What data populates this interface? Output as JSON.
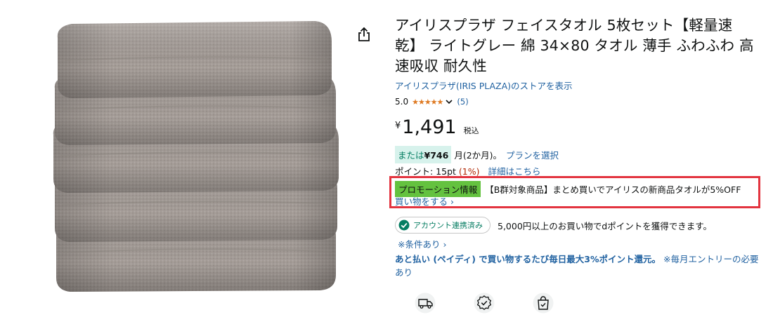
{
  "product": {
    "title": "アイリスプラザ フェイスタオル 5枚セット【軽量速乾】 ライトグレー 綿 34×80 タオル 薄手 ふわふわ 高速吸収 耐久性",
    "store_link": "アイリスプラザ(IRIS PLAZA)のストアを表示",
    "rating_value": "5.0",
    "stars": "★★★★★",
    "review_count": "(5)"
  },
  "price": {
    "currency_symbol": "¥",
    "amount": "1,491",
    "tax_label": "税込"
  },
  "installment": {
    "prefix": "または",
    "amount": "¥746",
    "suffix": "月(2か月)。",
    "plan_link": "プランを選択"
  },
  "points": {
    "label": "ポイント: 15pt",
    "percent": "(1%)",
    "detail_link": "詳細はこちら"
  },
  "promotion": {
    "badge": "プロモーション情報",
    "text": "【B群対象商品】まとめ買いでアイリスの新商品タオルが5%OFF",
    "shop_link": "買い物をする ›"
  },
  "account": {
    "badge_label": "アカウント連携済み",
    "dpoint_text": "5,000円以上のお買い物でdポイントを獲得できます。"
  },
  "terms_link": "※条件あり ›",
  "paidy": {
    "main": "あと払い (ペイディ) で買い物するたび毎日最大3%ポイント還元。",
    "note": "※毎月エントリーの必要あり"
  },
  "icons": {
    "share": "share-icon",
    "delivery": "delivery-truck-icon",
    "quality": "quality-badge-icon",
    "secure": "secure-bag-icon"
  },
  "colors": {
    "link": "#2162a1",
    "star": "#de7921",
    "promo_badge": "#64c23f",
    "highlight_border": "#e3343f",
    "installment_bg": "#d7f2ec"
  }
}
